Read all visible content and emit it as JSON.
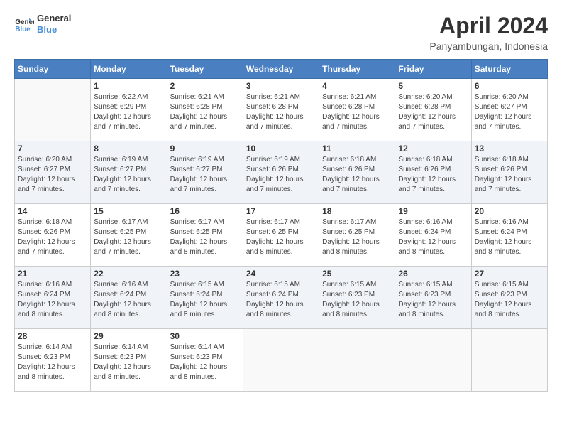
{
  "logo": {
    "line1": "General",
    "line2": "Blue"
  },
  "title": "April 2024",
  "subtitle": "Panyambungan, Indonesia",
  "days_of_week": [
    "Sunday",
    "Monday",
    "Tuesday",
    "Wednesday",
    "Thursday",
    "Friday",
    "Saturday"
  ],
  "weeks": [
    [
      {
        "day": "",
        "info": ""
      },
      {
        "day": "1",
        "info": "Sunrise: 6:22 AM\nSunset: 6:29 PM\nDaylight: 12 hours\nand 7 minutes."
      },
      {
        "day": "2",
        "info": "Sunrise: 6:21 AM\nSunset: 6:28 PM\nDaylight: 12 hours\nand 7 minutes."
      },
      {
        "day": "3",
        "info": "Sunrise: 6:21 AM\nSunset: 6:28 PM\nDaylight: 12 hours\nand 7 minutes."
      },
      {
        "day": "4",
        "info": "Sunrise: 6:21 AM\nSunset: 6:28 PM\nDaylight: 12 hours\nand 7 minutes."
      },
      {
        "day": "5",
        "info": "Sunrise: 6:20 AM\nSunset: 6:28 PM\nDaylight: 12 hours\nand 7 minutes."
      },
      {
        "day": "6",
        "info": "Sunrise: 6:20 AM\nSunset: 6:27 PM\nDaylight: 12 hours\nand 7 minutes."
      }
    ],
    [
      {
        "day": "7",
        "info": "Sunrise: 6:20 AM\nSunset: 6:27 PM\nDaylight: 12 hours\nand 7 minutes."
      },
      {
        "day": "8",
        "info": "Sunrise: 6:19 AM\nSunset: 6:27 PM\nDaylight: 12 hours\nand 7 minutes."
      },
      {
        "day": "9",
        "info": "Sunrise: 6:19 AM\nSunset: 6:27 PM\nDaylight: 12 hours\nand 7 minutes."
      },
      {
        "day": "10",
        "info": "Sunrise: 6:19 AM\nSunset: 6:26 PM\nDaylight: 12 hours\nand 7 minutes."
      },
      {
        "day": "11",
        "info": "Sunrise: 6:18 AM\nSunset: 6:26 PM\nDaylight: 12 hours\nand 7 minutes."
      },
      {
        "day": "12",
        "info": "Sunrise: 6:18 AM\nSunset: 6:26 PM\nDaylight: 12 hours\nand 7 minutes."
      },
      {
        "day": "13",
        "info": "Sunrise: 6:18 AM\nSunset: 6:26 PM\nDaylight: 12 hours\nand 7 minutes."
      }
    ],
    [
      {
        "day": "14",
        "info": "Sunrise: 6:18 AM\nSunset: 6:26 PM\nDaylight: 12 hours\nand 7 minutes."
      },
      {
        "day": "15",
        "info": "Sunrise: 6:17 AM\nSunset: 6:25 PM\nDaylight: 12 hours\nand 7 minutes."
      },
      {
        "day": "16",
        "info": "Sunrise: 6:17 AM\nSunset: 6:25 PM\nDaylight: 12 hours\nand 8 minutes."
      },
      {
        "day": "17",
        "info": "Sunrise: 6:17 AM\nSunset: 6:25 PM\nDaylight: 12 hours\nand 8 minutes."
      },
      {
        "day": "18",
        "info": "Sunrise: 6:17 AM\nSunset: 6:25 PM\nDaylight: 12 hours\nand 8 minutes."
      },
      {
        "day": "19",
        "info": "Sunrise: 6:16 AM\nSunset: 6:24 PM\nDaylight: 12 hours\nand 8 minutes."
      },
      {
        "day": "20",
        "info": "Sunrise: 6:16 AM\nSunset: 6:24 PM\nDaylight: 12 hours\nand 8 minutes."
      }
    ],
    [
      {
        "day": "21",
        "info": "Sunrise: 6:16 AM\nSunset: 6:24 PM\nDaylight: 12 hours\nand 8 minutes."
      },
      {
        "day": "22",
        "info": "Sunrise: 6:16 AM\nSunset: 6:24 PM\nDaylight: 12 hours\nand 8 minutes."
      },
      {
        "day": "23",
        "info": "Sunrise: 6:15 AM\nSunset: 6:24 PM\nDaylight: 12 hours\nand 8 minutes."
      },
      {
        "day": "24",
        "info": "Sunrise: 6:15 AM\nSunset: 6:24 PM\nDaylight: 12 hours\nand 8 minutes."
      },
      {
        "day": "25",
        "info": "Sunrise: 6:15 AM\nSunset: 6:23 PM\nDaylight: 12 hours\nand 8 minutes."
      },
      {
        "day": "26",
        "info": "Sunrise: 6:15 AM\nSunset: 6:23 PM\nDaylight: 12 hours\nand 8 minutes."
      },
      {
        "day": "27",
        "info": "Sunrise: 6:15 AM\nSunset: 6:23 PM\nDaylight: 12 hours\nand 8 minutes."
      }
    ],
    [
      {
        "day": "28",
        "info": "Sunrise: 6:14 AM\nSunset: 6:23 PM\nDaylight: 12 hours\nand 8 minutes."
      },
      {
        "day": "29",
        "info": "Sunrise: 6:14 AM\nSunset: 6:23 PM\nDaylight: 12 hours\nand 8 minutes."
      },
      {
        "day": "30",
        "info": "Sunrise: 6:14 AM\nSunset: 6:23 PM\nDaylight: 12 hours\nand 8 minutes."
      },
      {
        "day": "",
        "info": ""
      },
      {
        "day": "",
        "info": ""
      },
      {
        "day": "",
        "info": ""
      },
      {
        "day": "",
        "info": ""
      }
    ]
  ]
}
